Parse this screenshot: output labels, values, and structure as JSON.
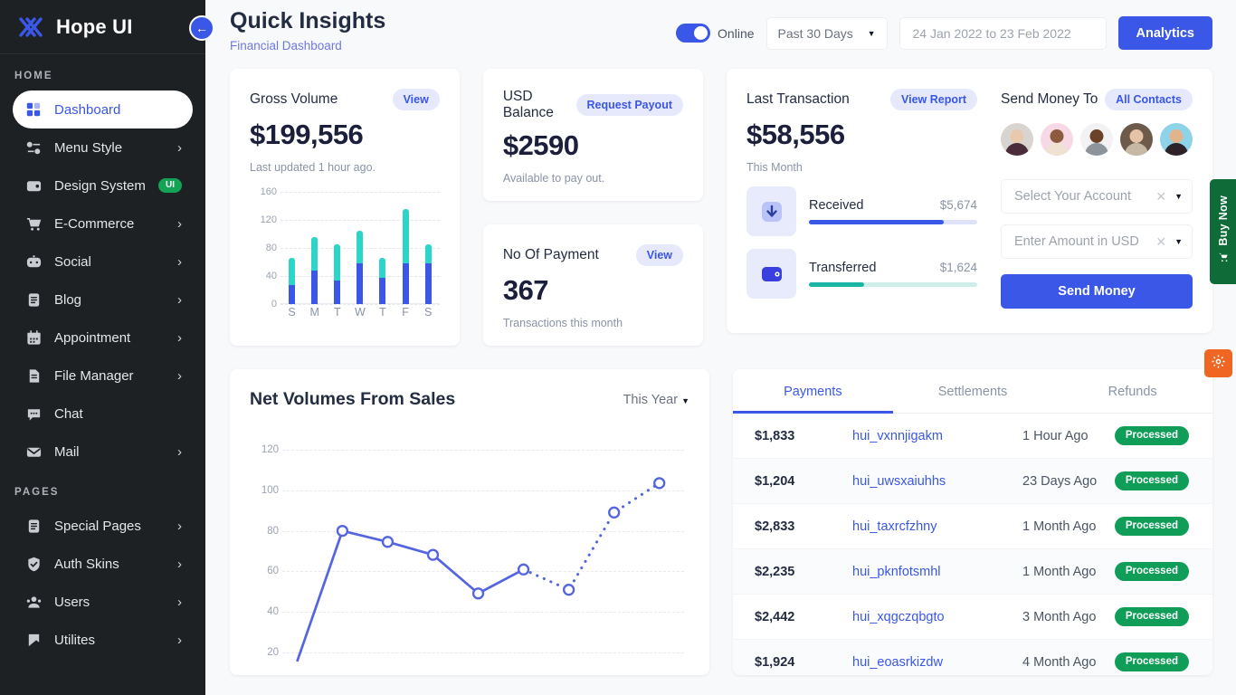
{
  "sidebar": {
    "brand": "Hope UI",
    "brand_logo_icon": "hope-logo-icon",
    "collapse_icon": "arrow-left-icon",
    "sections": [
      {
        "label": "HOME",
        "items": [
          {
            "label": "Dashboard",
            "icon": "grid-icon",
            "active": true,
            "chevron": false,
            "badge": ""
          },
          {
            "label": "Menu Style",
            "icon": "sliders-icon",
            "active": false,
            "chevron": true,
            "badge": ""
          },
          {
            "label": "Design System",
            "icon": "wallet-icon",
            "active": false,
            "chevron": false,
            "badge": "UI"
          },
          {
            "label": "E-Commerce",
            "icon": "cart-icon",
            "active": false,
            "chevron": true,
            "badge": ""
          },
          {
            "label": "Social",
            "icon": "social-icon",
            "active": false,
            "chevron": true,
            "badge": ""
          },
          {
            "label": "Blog",
            "icon": "document-icon",
            "active": false,
            "chevron": true,
            "badge": ""
          },
          {
            "label": "Appointment",
            "icon": "calendar-icon",
            "active": false,
            "chevron": true,
            "badge": ""
          },
          {
            "label": "File Manager",
            "icon": "file-icon",
            "active": false,
            "chevron": true,
            "badge": ""
          },
          {
            "label": "Chat",
            "icon": "chat-icon",
            "active": false,
            "chevron": false,
            "badge": ""
          },
          {
            "label": "Mail",
            "icon": "mail-icon",
            "active": false,
            "chevron": true,
            "badge": ""
          }
        ]
      },
      {
        "label": "PAGES",
        "items": [
          {
            "label": "Special Pages",
            "icon": "document-icon",
            "active": false,
            "chevron": true,
            "badge": ""
          },
          {
            "label": "Auth Skins",
            "icon": "shield-icon",
            "active": false,
            "chevron": true,
            "badge": ""
          },
          {
            "label": "Users",
            "icon": "users-icon",
            "active": false,
            "chevron": true,
            "badge": ""
          },
          {
            "label": "Utilites",
            "icon": "bookmark-icon",
            "active": false,
            "chevron": true,
            "badge": ""
          }
        ]
      }
    ]
  },
  "header": {
    "title": "Quick Insights",
    "subtitle": "Financial Dashboard",
    "toggle_label": "Online",
    "toggle_on": true,
    "range_select": "Past 30 Days",
    "date_range": "24 Jan 2022 to 23 Feb 2022",
    "analytics_button": "Analytics"
  },
  "gross_volume": {
    "title": "Gross Volume",
    "action": "View",
    "value": "$199,556",
    "note": "Last updated 1 hour ago."
  },
  "usd_balance": {
    "title": "USD Balance",
    "action": "Request Payout",
    "value": "$2590",
    "note": "Available to pay out."
  },
  "no_of_payment": {
    "title": "No Of Payment",
    "action": "View",
    "value": "367",
    "note": "Transactions this month"
  },
  "last_transaction": {
    "title": "Last Transaction",
    "action": "View Report",
    "value": "$58,556",
    "note": "This Month",
    "items": [
      {
        "name": "Received",
        "amount": "$5,674",
        "percent": 80,
        "color": "#3a57e8",
        "track": "#dfe3f9",
        "icon": "download-arrow-icon",
        "icon_bg": "#e8ebfc"
      },
      {
        "name": "Transferred",
        "amount": "$1,624",
        "percent": 33,
        "color": "#1bb5a5",
        "track": "#cfeeea",
        "icon": "wallet-icon",
        "icon_bg": "#e8ebfc"
      }
    ]
  },
  "send_money": {
    "title": "Send Money To",
    "action": "All Contacts",
    "contacts": [
      {
        "name": "contact-1",
        "bg": "#d8d4d0",
        "skin": "#e8c9ad",
        "shirt": "#4a2b3a"
      },
      {
        "name": "contact-2",
        "bg": "#f6d9e4",
        "skin": "#8c5a3c",
        "shirt": "#f0e2d2"
      },
      {
        "name": "contact-3",
        "bg": "#f2f2f4",
        "skin": "#6b4228",
        "shirt": "#8e949c"
      },
      {
        "name": "contact-4",
        "bg": "#6d5a4a",
        "skin": "#e6c3a6",
        "shirt": "#c6b8a5"
      },
      {
        "name": "contact-5",
        "bg": "#8ed3ea",
        "skin": "#e3b48c",
        "shirt": "#2c2228"
      }
    ],
    "account_placeholder": "Select Your Account",
    "amount_placeholder": "Enter Amount in USD",
    "send_button": "Send Money"
  },
  "net_volumes": {
    "title": "Net Volumes From Sales",
    "range": "This Year"
  },
  "transactions": {
    "tabs": [
      {
        "label": "Payments",
        "active": true
      },
      {
        "label": "Settlements",
        "active": false
      },
      {
        "label": "Refunds",
        "active": false
      }
    ],
    "rows": [
      {
        "amount": "$1,833",
        "id": "hui_vxnnjigakm",
        "time": "1 Hour Ago",
        "status": "Processed"
      },
      {
        "amount": "$1,204",
        "id": "hui_uwsxaiuhhs",
        "time": "23 Days Ago",
        "status": "Processed"
      },
      {
        "amount": "$2,833",
        "id": "hui_taxrcfzhny",
        "time": "1 Month Ago",
        "status": "Processed"
      },
      {
        "amount": "$2,235",
        "id": "hui_pknfotsmhl",
        "time": "1 Month Ago",
        "status": "Processed"
      },
      {
        "amount": "$2,442",
        "id": "hui_xqgczqbgto",
        "time": "3 Month Ago",
        "status": "Processed"
      },
      {
        "amount": "$1,924",
        "id": "hui_eoasrkizdw",
        "time": "4 Month Ago",
        "status": "Processed"
      }
    ]
  },
  "floating": {
    "buy_now_label": "Buy Now",
    "buy_now_icon": "cart-icon",
    "settings_icon": "gear-icon"
  },
  "chart_data": [
    {
      "type": "bar",
      "title": "Gross Volume",
      "stacked": true,
      "categories": [
        "S",
        "M",
        "T",
        "W",
        "T",
        "F",
        "S"
      ],
      "series": [
        {
          "name": "Base",
          "color": "#3a57e8",
          "values": [
            27,
            48,
            33,
            58,
            38,
            58,
            58
          ]
        },
        {
          "name": "Upper",
          "color": "#2dd4c8",
          "values": [
            39,
            48,
            52,
            47,
            28,
            78,
            27
          ]
        }
      ],
      "totals": [
        66,
        96,
        85,
        105,
        66,
        136,
        85
      ],
      "ylim": [
        0,
        160
      ],
      "yticks": [
        0,
        40,
        80,
        120,
        160
      ],
      "xlabel": "",
      "ylabel": "",
      "grid": true,
      "legend": "none"
    },
    {
      "type": "line",
      "title": "Net Volumes From Sales",
      "x": [
        1,
        2,
        3,
        4,
        5,
        6,
        7,
        8,
        9
      ],
      "values": [
        10,
        81,
        75,
        68,
        47,
        60,
        49,
        91,
        107
      ],
      "solid_until_index": 5,
      "color": "#5565e0",
      "ylim": [
        10,
        130
      ],
      "yticks": [
        20,
        40,
        60,
        80,
        100,
        120
      ],
      "xlabel": "",
      "ylabel": "",
      "grid": true,
      "legend": "none",
      "marker": "open-circle"
    }
  ]
}
